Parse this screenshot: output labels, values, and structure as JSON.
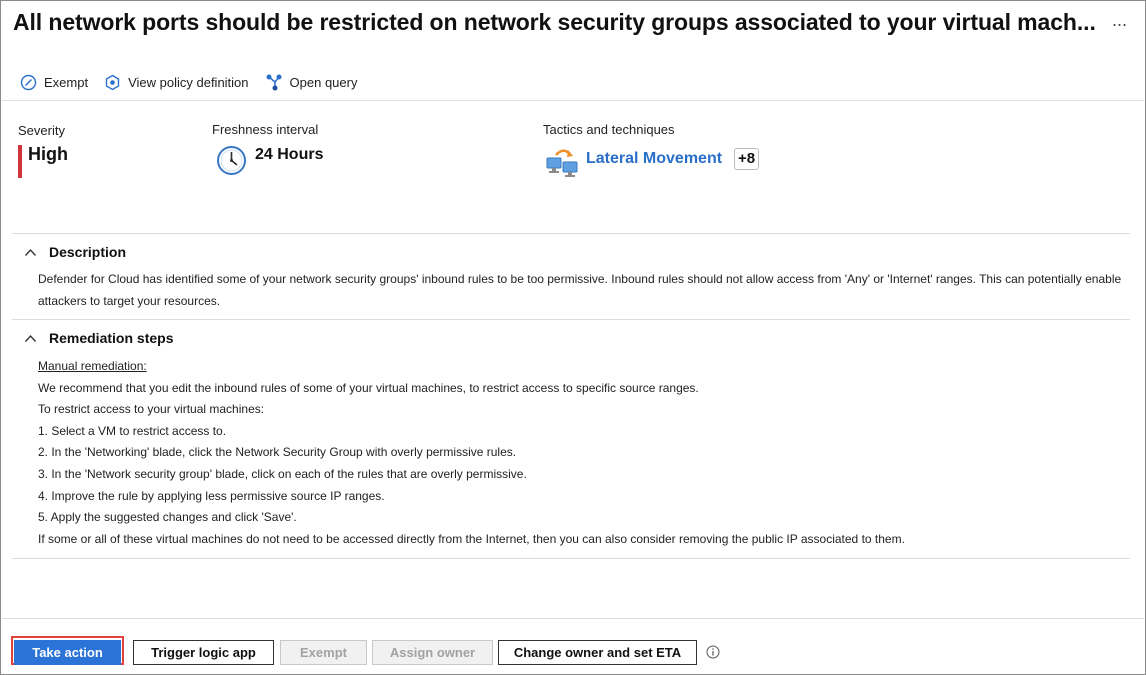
{
  "header": {
    "title": "All network ports should be restricted on network security groups associated to your virtual mach...",
    "more_label": "..."
  },
  "toolbar": {
    "items": [
      {
        "label": "Exempt",
        "icon": "exempt-icon"
      },
      {
        "label": "View policy definition",
        "icon": "policy-icon"
      },
      {
        "label": "Open query",
        "icon": "query-icon"
      }
    ]
  },
  "meta": {
    "severity": {
      "label": "Severity",
      "value": "High",
      "color": "#d13438"
    },
    "freshness": {
      "label": "Freshness interval",
      "value": "24 Hours",
      "icon": "clock-icon"
    },
    "tactics": {
      "label": "Tactics and techniques",
      "value": "Lateral Movement",
      "extra": "+8",
      "icon": "lateral-movement-icon",
      "link_color": "#2a6fc9"
    }
  },
  "description": {
    "title": "Description",
    "text": "Defender for Cloud has identified some of your network security groups' inbound rules to be too permissive. Inbound rules should not allow access from 'Any' or 'Internet' ranges. This can potentially enable attackers to target your resources."
  },
  "remediation": {
    "title": "Remediation steps",
    "lines": [
      "Manual remediation:",
      "We recommend that you edit the inbound rules of some of your virtual machines, to restrict access to specific source ranges.",
      "To restrict access to your virtual machines:",
      "1. Select a VM to restrict access to.",
      "2. In the 'Networking' blade, click the Network Security Group with overly permissive rules.",
      "3. In the 'Network security group' blade, click on each of the rules that are overly permissive.",
      "4. Improve the rule by applying less permissive source IP ranges.",
      "5. Apply the suggested changes and click 'Save'.",
      "If some or all of these virtual machines do not need to be accessed directly from the Internet, then you can also consider removing the public IP associated to them."
    ]
  },
  "actions": {
    "take_action": "Take action",
    "trigger_logic_app": "Trigger logic app",
    "exempt": "Exempt",
    "assign_owner": "Assign owner",
    "change_owner": "Change owner and set ETA",
    "primary_color": "#2b73d6",
    "highlight_color": "#e0423e"
  }
}
